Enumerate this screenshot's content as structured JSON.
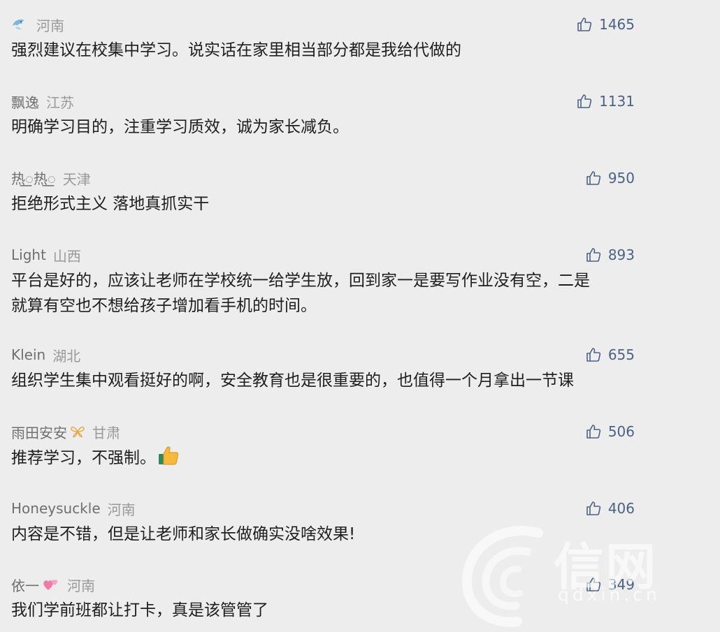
{
  "comments": [
    {
      "user": "",
      "user_icon": "dolphin-icon",
      "region": "河南",
      "likes": "1465",
      "text": "强烈建议在校集中学习。说实话在家里相当部分都是我给代做的"
    },
    {
      "user": "飘逸",
      "region": "江苏",
      "likes": "1131",
      "text": "明确学习目的，注重学习质效，诚为家长减负。"
    },
    {
      "user": "热꯭热꯭",
      "region": "天津",
      "likes": "950",
      "text": "拒绝形式主义 落地真抓实干"
    },
    {
      "user": "Light",
      "region": "山西",
      "likes": "893",
      "text_lines": [
        "平台是好的，应该让老师在学校统一给学生放，回到家一是要写作业没有空，二是",
        "就算有空也不想给孩子增加看手机的时间。"
      ]
    },
    {
      "user": "Klein",
      "region": "湖北",
      "likes": "655",
      "text": "组织学生集中观看挺好的啊，安全教育也是很重要的，也值得一个月拿出一节课"
    },
    {
      "user": "雨田安安",
      "user_badge": "butterfly-icon",
      "region": "甘肃",
      "likes": "506",
      "text": "推荐学习，不强制。",
      "text_emoji": "thumbs-up-emoji"
    },
    {
      "user": "Honeysuckle",
      "region": "河南",
      "likes": "406",
      "text": "内容是不错，但是让老师和家长做确实没啥效果!"
    },
    {
      "user": "依一",
      "user_badge": "hearts-icon",
      "region": "河南",
      "likes": "349",
      "text": "我们学前班都让打卡，真是该管管了"
    }
  ],
  "watermark": {
    "logo_text": "信网",
    "domain": "qdxin.cn"
  },
  "colors": {
    "background": "#ededed",
    "like_color": "#4b6285",
    "region_color": "#999999",
    "text_color": "#1e1e1e"
  }
}
